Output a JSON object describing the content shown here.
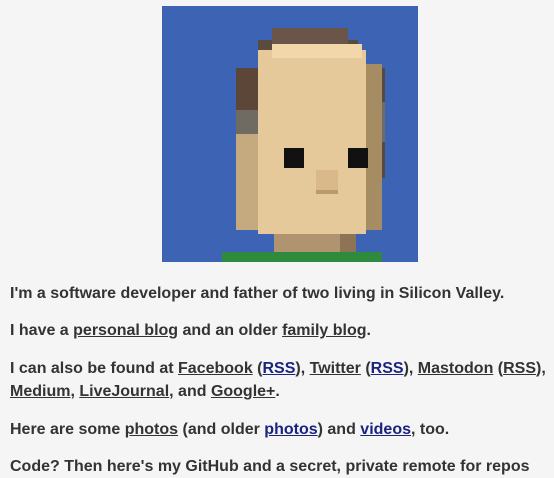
{
  "avatar": {
    "alt": "Voxel avatar",
    "bg_color": "#3d63b5"
  },
  "intro": "I'm a software developer and father of two living in Silicon Valley.",
  "blogs": {
    "prefix": "I have a ",
    "personal_blog": "personal blog",
    "middle": " and an older ",
    "family_blog": "family blog",
    "suffix": "."
  },
  "social": {
    "prefix": "I can also be found at ",
    "facebook": "Facebook",
    "rss": "RSS",
    "twitter": "Twitter",
    "mastodon": "Mastodon",
    "medium": "Medium",
    "livejournal": "LiveJournal",
    "googleplus": "Google+",
    "open_paren": " (",
    "close_sep": "), ",
    "comma": ", ",
    "and_text": ", and ",
    "end": "."
  },
  "media": {
    "prefix": "Here are some ",
    "photos": "photos",
    "older_prefix": " (and older ",
    "older_photos": "photos",
    "and_text": ") and ",
    "videos": "videos",
    "suffix": ", too."
  },
  "code_line": "Code? Then here's my GitHub and a secret, private remote for repos"
}
